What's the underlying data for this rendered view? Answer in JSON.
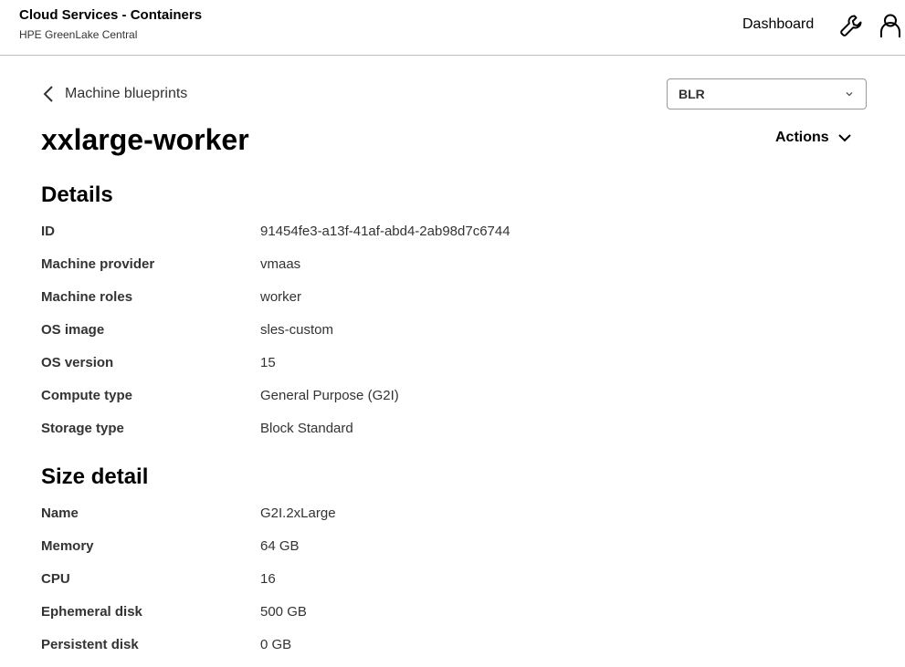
{
  "header": {
    "title": "Cloud Services - Containers",
    "subtitle": "HPE GreenLake Central",
    "nav_dashboard": "Dashboard",
    "icons": [
      "wrench-icon",
      "user-icon"
    ]
  },
  "back_link": {
    "label": "Machine blueprints",
    "icon": "chevron-left-icon"
  },
  "region_select": {
    "value": "BLR",
    "icon": "chevron-down-icon"
  },
  "title": "xxlarge-worker",
  "actions": {
    "label": "Actions",
    "icon": "chevron-down-icon"
  },
  "details": {
    "heading": "Details",
    "rows": [
      {
        "key": "ID",
        "value": "91454fe3-a13f-41af-abd4-2ab98d7c6744"
      },
      {
        "key": "Machine provider",
        "value": "vmaas"
      },
      {
        "key": "Machine roles",
        "value": "worker"
      },
      {
        "key": "OS image",
        "value": "sles-custom"
      },
      {
        "key": "OS version",
        "value": "15"
      },
      {
        "key": "Compute type",
        "value": "General Purpose (G2I)"
      },
      {
        "key": "Storage type",
        "value": "Block Standard"
      }
    ]
  },
  "size_detail": {
    "heading": "Size detail",
    "rows": [
      {
        "key": "Name",
        "value": "G2I.2xLarge"
      },
      {
        "key": "Memory",
        "value": "64 GB"
      },
      {
        "key": "CPU",
        "value": "16"
      },
      {
        "key": "Ephemeral disk",
        "value": "500 GB"
      },
      {
        "key": "Persistent disk",
        "value": "0 GB"
      }
    ]
  }
}
